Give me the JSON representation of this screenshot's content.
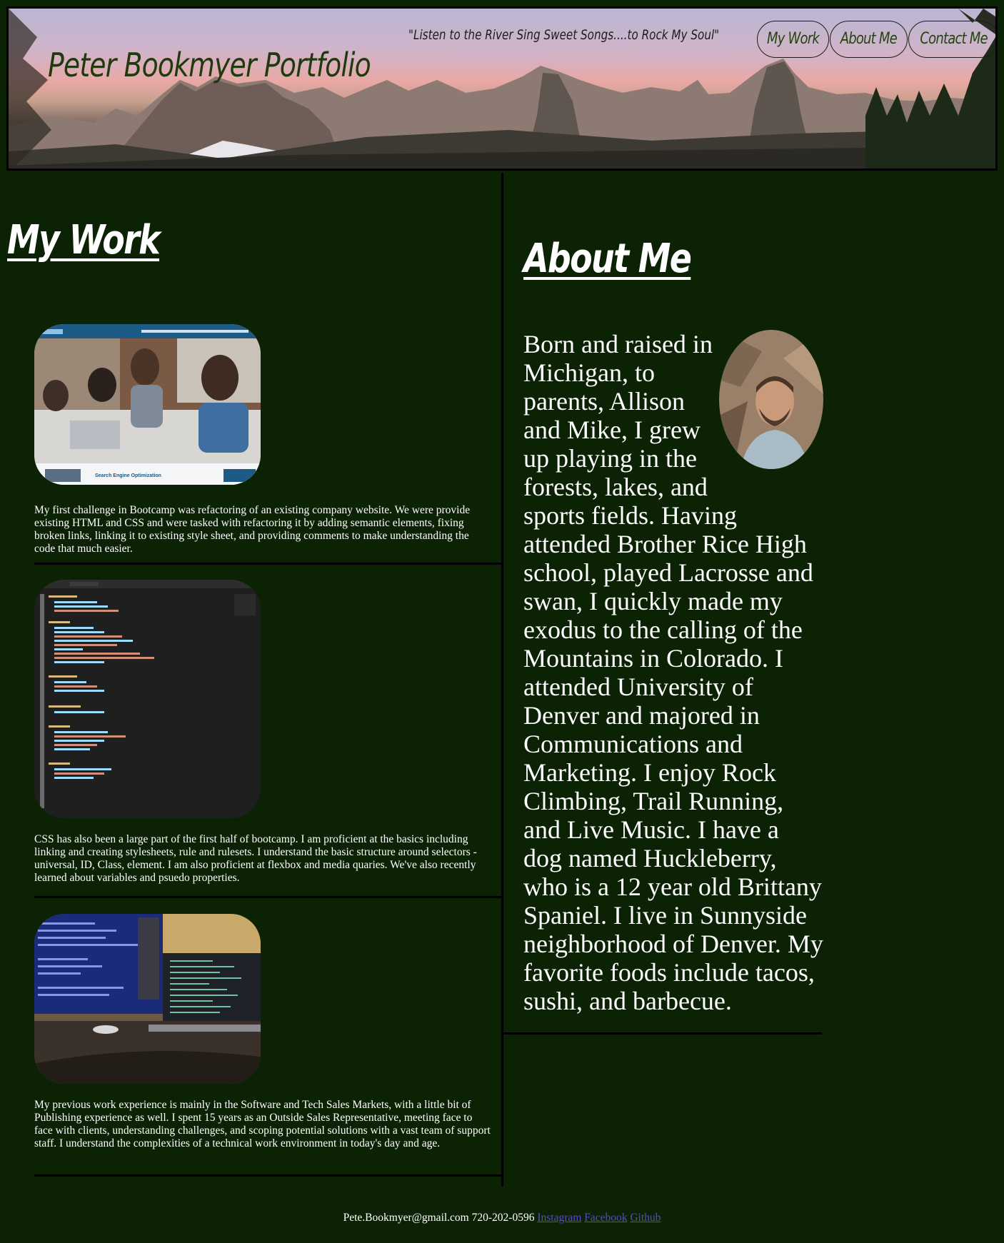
{
  "header": {
    "title": "Peter Bookmyer Portfolio",
    "tagline": "\"Listen to the River Sing Sweet Songs....to Rock My Soul\"",
    "nav": [
      "My Work",
      "About Me",
      "Contact Me"
    ]
  },
  "my_work": {
    "heading": "My Work",
    "projects": [
      {
        "image": "website-screenshot-meeting",
        "image_caption": "Search Engine Optimization",
        "text": "My first challenge in Bootcamp was refactoring of an existing company website. We were provide existing HTML and CSS and were tasked with refactoring it by adding semantic elements, fixing broken links, linking it to existing style sheet, and providing comments to make understanding the code that much easier."
      },
      {
        "image": "css-code-editor",
        "text": "CSS has also been a large part of the first half of bootcamp. I am proficient at the basics including linking and creating stylesheets, rule and rulesets. I understand the basic structure around selectors - universal, ID, Class, element. I am also proficient at flexbox and media quaries. We've also recently learned about variables and psuedo properties."
      },
      {
        "image": "desk-monitors",
        "text": "My previous work experience is mainly in the Software and Tech Sales Markets, with a little bit of Publishing experience as well. I spent 15 years as an Outside Sales Representative, meeting face to face with clients, understanding challenges, and scoping potential solutions with a vast team of support staff. I understand the complexities of a technical work environment in today's day and age."
      }
    ]
  },
  "about_me": {
    "heading": "About Me",
    "portrait": "portrait-photo",
    "text": "Born and raised in Michigan, to parents, Allison and Mike, I grew up playing in the forests, lakes, and sports fields. Having attended Brother Rice High school, played Lacrosse and swan, I quickly made my exodus to the calling of the Mountains in Colorado. I attended University of Denver and majored in Communications and Marketing. I enjoy Rock Climbing, Trail Running, and Live Music. I have a dog named Huckleberry, who is a 12 year old Brittany Spaniel. I live in Sunnyside neighborhood of Denver. My favorite foods include tacos, sushi, and barbecue."
  },
  "footer": {
    "contact": "Pete.Bookmyer@gmail.com 720-202-0596",
    "links": [
      "Instagram",
      "Facebook",
      "Github"
    ]
  },
  "colors": {
    "background": "#0b2204",
    "title_green": "#1f3a0c",
    "link": "#5c48c9"
  }
}
